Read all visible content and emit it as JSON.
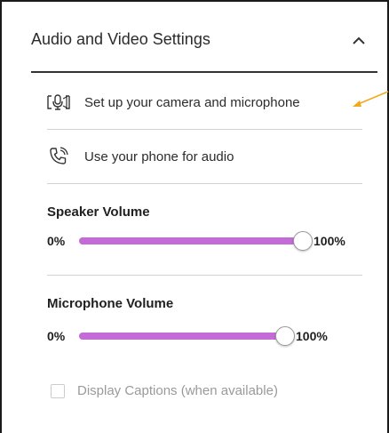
{
  "panel": {
    "title": "Audio and Video Settings"
  },
  "menu": {
    "camera_label": "Set up your camera and microphone",
    "phone_label": "Use your phone for audio"
  },
  "speaker": {
    "heading": "Speaker Volume",
    "min_label": "0%",
    "max_label": "100%",
    "value_percent": 100
  },
  "microphone": {
    "heading": "Microphone Volume",
    "min_label": "0%",
    "max_label": "100%",
    "value_percent": 100
  },
  "captions": {
    "label": "Display Captions (when available)",
    "checked": false,
    "disabled": true
  },
  "icons": {
    "collapse": "chevron-up-icon",
    "camera": "camera-microphone-icon",
    "phone": "phone-call-icon",
    "annotation": "annotation-arrow-icon"
  },
  "colors": {
    "slider_fill": "#c46bd8",
    "annotation": "#f2a81d"
  }
}
